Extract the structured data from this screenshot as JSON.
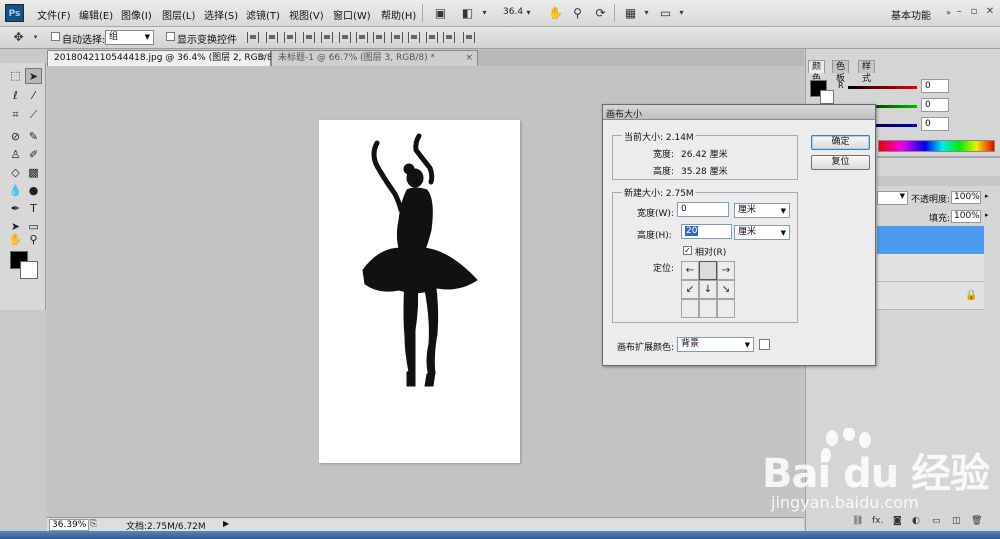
{
  "app": {
    "logo": "Ps"
  },
  "menu": [
    "文件(F)",
    "编辑(E)",
    "图像(I)",
    "图层(L)",
    "选择(S)",
    "滤镜(T)",
    "视图(V)",
    "窗口(W)",
    "帮助(H)"
  ],
  "appbar": {
    "zoom": "36.4",
    "workspace": "基本功能",
    "icons": [
      "bridge-icon",
      "mini-bridge-icon",
      "hand-icon",
      "zoom-icon",
      "rotate-view-icon",
      "arrange-icon",
      "screen-mode-icon"
    ]
  },
  "options": {
    "auto_select_label": "自动选择:",
    "auto_select_value": "组",
    "show_transform_label": "显示变换控件"
  },
  "tabs": [
    {
      "label": "20180421105444​18.jpg @ 36.4% (图层 2, RGB/8#) *",
      "active": true
    },
    {
      "label": "未标题-1 @ 66.7% (图层 3, RGB/8) *",
      "active": false
    }
  ],
  "status": {
    "zoom": "36.39%",
    "doc": "文档:2.75M/6.72M"
  },
  "panels": {
    "color_tabs": [
      "颜色",
      "色板",
      "样式"
    ],
    "rgb_label": "R",
    "rgb_values": [
      "0",
      "0",
      "0"
    ],
    "opacity_label": "不透明度:",
    "opacity_value": "100%",
    "fill_label": "填充:",
    "fill_value": "100%"
  },
  "dialog": {
    "title": "画布大小",
    "current_size": "当前大小: 2.14M",
    "width_label": "宽度:",
    "width_value": "26.42 厘米",
    "height_label": "高度:",
    "height_value": "35.28 厘米",
    "new_size": "新建大小: 2.75M",
    "new_width_label": "宽度(W):",
    "new_width_value": "0",
    "new_height_label": "高度(H):",
    "new_height_value": "20",
    "unit": "厘米",
    "relative_label": "相对(R)",
    "relative_checked": true,
    "anchor_label": "定位:",
    "extension_color_label": "画布扩展颜色:",
    "extension_color_value": "背景",
    "ok": "确定",
    "reset": "复位"
  },
  "watermark": {
    "logo": "Bai du 经验",
    "url": "jingyan.baidu.com"
  }
}
